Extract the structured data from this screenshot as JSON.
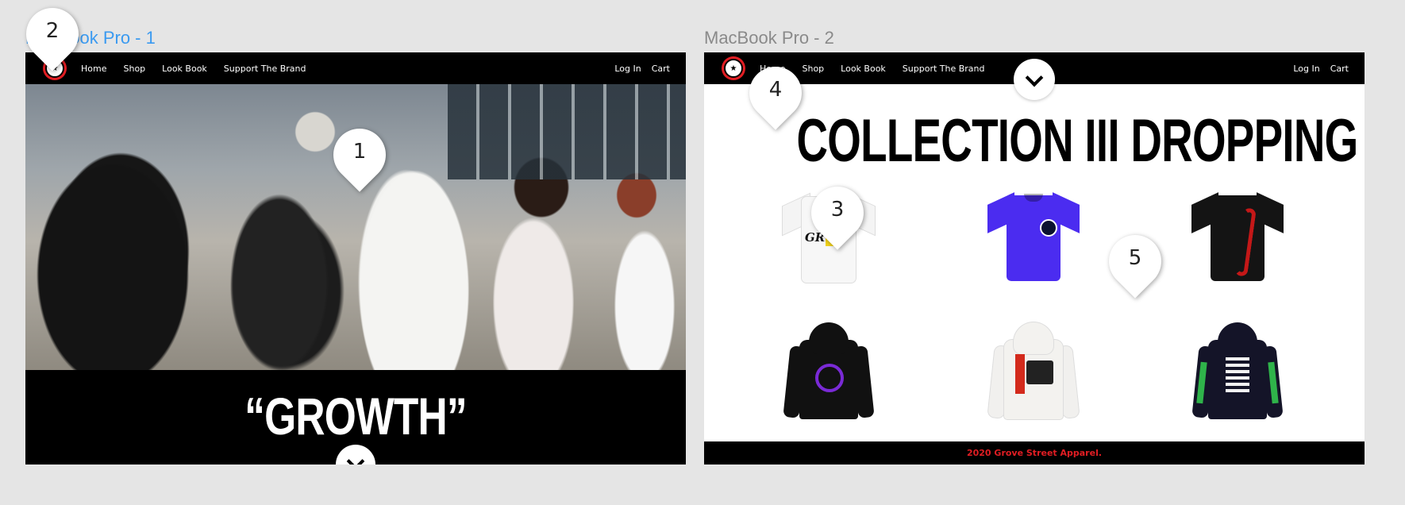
{
  "frames": [
    {
      "title": "MacBook Pro - 1",
      "nav": {
        "links": [
          "Home",
          "Shop",
          "Look Book",
          "Support The Brand"
        ],
        "right": [
          "Log In",
          "Cart"
        ]
      },
      "hero_title": "“GROWTH”"
    },
    {
      "title": "MacBook Pro - 2",
      "nav": {
        "links": [
          "Home",
          "Shop",
          "Look Book",
          "Support The Brand"
        ],
        "right": [
          "Log In",
          "Cart"
        ]
      },
      "headline": "COLLECTION III DROPPING SOON",
      "footer": "2020 Grove Street Apparel."
    }
  ],
  "pins": [
    "1",
    "2",
    "3",
    "4",
    "5"
  ],
  "colors": {
    "accent_red": "#e11d23",
    "link_blue": "#3a9af0",
    "tee_blue": "#4b2cf0",
    "hoodie_purple": "#7a2ad6"
  },
  "products": [
    {
      "kind": "tee",
      "color": "white",
      "print_text": "GR"
    },
    {
      "kind": "tee",
      "color": "blue"
    },
    {
      "kind": "shirt",
      "color": "black-red-snake"
    },
    {
      "kind": "hoodie",
      "color": "black-purple-logo"
    },
    {
      "kind": "hoodie",
      "color": "white-red-print"
    },
    {
      "kind": "hoodie",
      "color": "black-skeleton"
    }
  ]
}
